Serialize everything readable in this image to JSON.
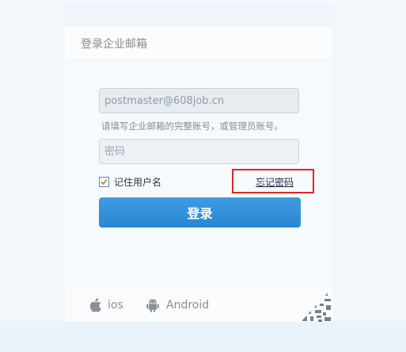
{
  "panel": {
    "title": "登录企业邮箱"
  },
  "form": {
    "email_value": "postmaster@608job.cn",
    "email_hint": "请填写企业邮箱的完整账号，或管理员账号。",
    "password_placeholder": "密码",
    "remember_label": "记住用户名",
    "remember_checked": true,
    "forgot_label": "忘记密码",
    "login_label": "登录"
  },
  "apps": {
    "ios_label": "ios",
    "android_label": "Android"
  },
  "colors": {
    "accent": "#3a94dc",
    "highlight_border": "#e0242a"
  }
}
